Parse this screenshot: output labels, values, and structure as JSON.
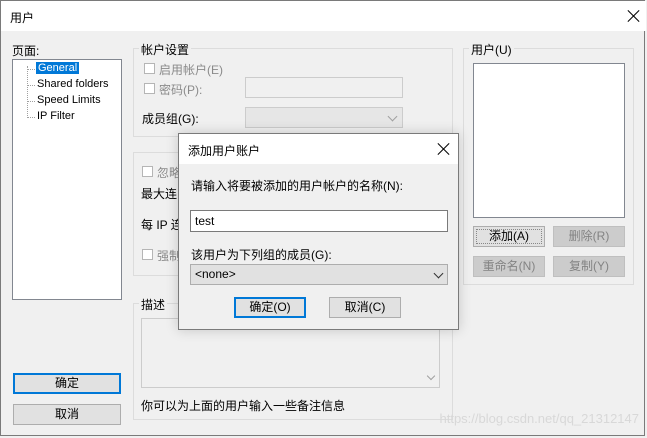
{
  "window": {
    "title": "用户"
  },
  "pages_panel": {
    "label": "页面:",
    "items": [
      "General",
      "Shared folders",
      "Speed Limits",
      "IP Filter"
    ],
    "selected": "General"
  },
  "account_settings": {
    "title": "帐户设置",
    "enable_account": "启用帐户(E)",
    "password": "密码(P):",
    "member_group": "成员组(G):"
  },
  "partial_group": {
    "ignore_text": "忽略",
    "max_conn_text": "最大连",
    "per_ip_text": "每 IP 连",
    "force_text": "强制"
  },
  "description": {
    "title": "描述",
    "hint": "你可以为上面的用户输入一些备注信息"
  },
  "users_panel": {
    "label": "用户(U)",
    "add": "添加(A)",
    "delete": "删除(R)",
    "rename": "重命名(N)",
    "copy": "复制(Y)"
  },
  "main_buttons": {
    "ok": "确定",
    "cancel": "取消"
  },
  "dialog": {
    "title": "添加用户账户",
    "prompt": "请输入将要被添加的用户帐户的名称(N):",
    "username_value": "test",
    "group_label": "该用户为下列组的成员(G):",
    "group_selected": "<none>",
    "ok": "确定(O)",
    "cancel": "取消(C)"
  },
  "watermark": "https://blog.csdn.net/qq_21312147",
  "colors": {
    "selection": "#0078d7",
    "window_bg": "#f0f0f0"
  }
}
